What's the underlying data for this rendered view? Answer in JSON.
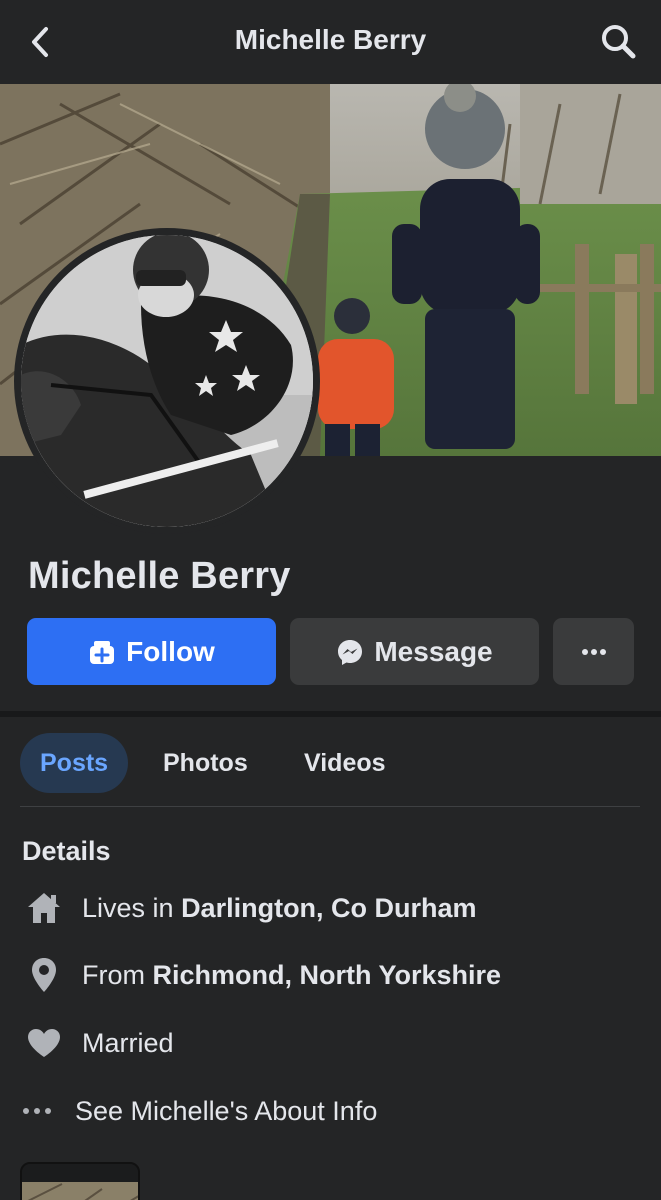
{
  "header": {
    "title": "Michelle Berry"
  },
  "profile": {
    "name": "Michelle Berry"
  },
  "actions": {
    "follow_label": "Follow",
    "message_label": "Message"
  },
  "tabs": [
    {
      "label": "Posts",
      "active": true
    },
    {
      "label": "Photos",
      "active": false
    },
    {
      "label": "Videos",
      "active": false
    }
  ],
  "details": {
    "heading": "Details",
    "lives_prefix": "Lives in ",
    "lives_place": "Darlington, Co Durham",
    "from_prefix": "From ",
    "from_place": "Richmond, North Yorkshire",
    "relationship": "Married",
    "about_link": "See Michelle's About Info"
  },
  "colors": {
    "background": "#242526",
    "follow_button": "#2d6ff3",
    "secondary_button": "#3a3b3c",
    "active_tab_bg": "#263951",
    "active_tab_text": "#6aa6ff"
  },
  "icons": {
    "back": "chevron-left-icon",
    "search": "search-icon",
    "follow": "follow-icon",
    "message": "messenger-icon",
    "more": "more-dots-icon",
    "home": "home-icon",
    "location": "location-pin-icon",
    "relationship": "heart-icon",
    "about": "more-dots-icon"
  }
}
